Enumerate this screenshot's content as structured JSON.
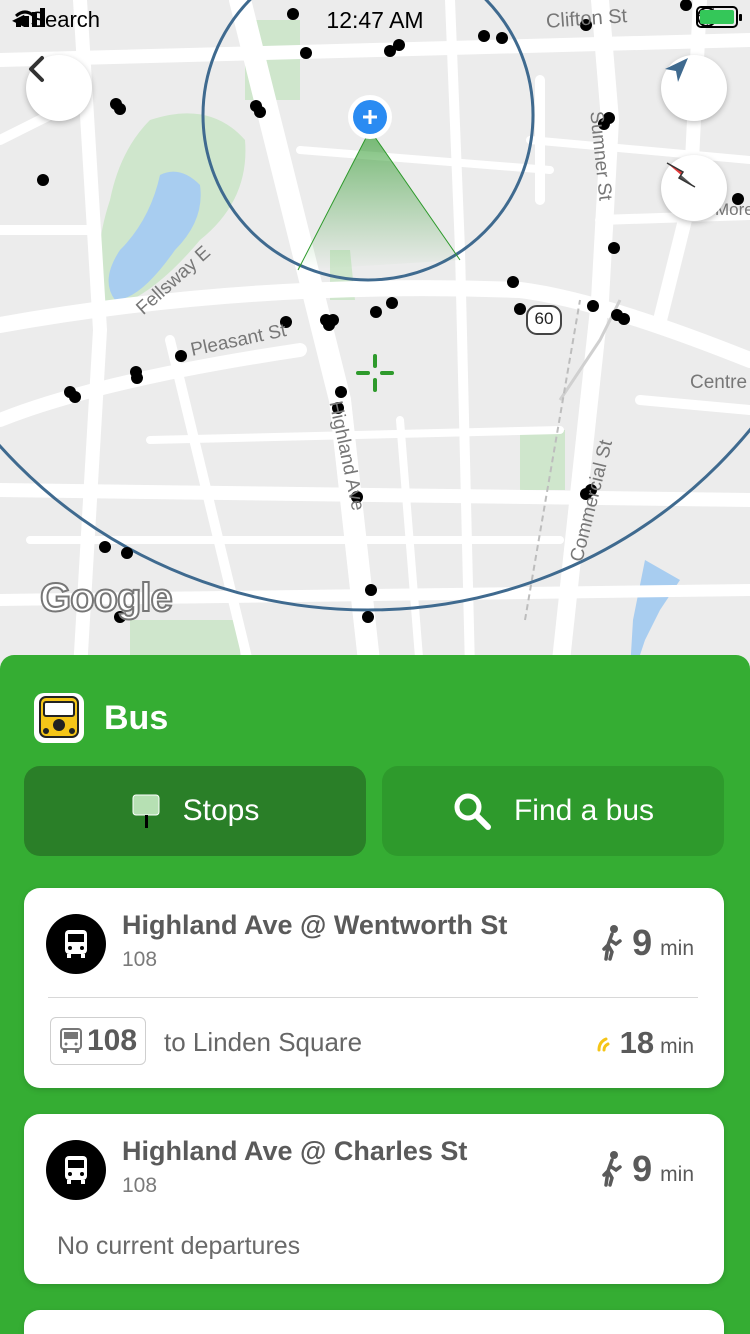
{
  "status_bar": {
    "back_label": "Search",
    "time": "12:47 AM"
  },
  "map": {
    "labels": {
      "clifton": "Clifton St",
      "sumner": "Sumner St",
      "fellsway": "Fellsway E",
      "pleasant": "Pleasant St",
      "highland": "Highland Ave",
      "centre": "Centre",
      "commercial": "Commercial St",
      "route_shield": "60",
      "more": "More"
    },
    "google_logo": "Google"
  },
  "sheet": {
    "title": "Bus",
    "tabs": {
      "stops": "Stops",
      "find": "Find a bus"
    },
    "stops": [
      {
        "name": "Highland Ave @ Wentworth St",
        "route": "108",
        "walk_minutes": "9",
        "walk_unit": "min",
        "departure": {
          "route_number": "108",
          "destination": "to Linden Square",
          "minutes": "18",
          "unit": "min"
        }
      },
      {
        "name": "Highland Ave @ Charles St",
        "route": "108",
        "walk_minutes": "9",
        "walk_unit": "min",
        "no_departures": "No current departures"
      }
    ]
  },
  "colors": {
    "brand_green": "#35ad33",
    "stops_tab": "#2a7f28",
    "find_tab": "#2e9a2c",
    "realtime_icon": "#f5c518"
  }
}
